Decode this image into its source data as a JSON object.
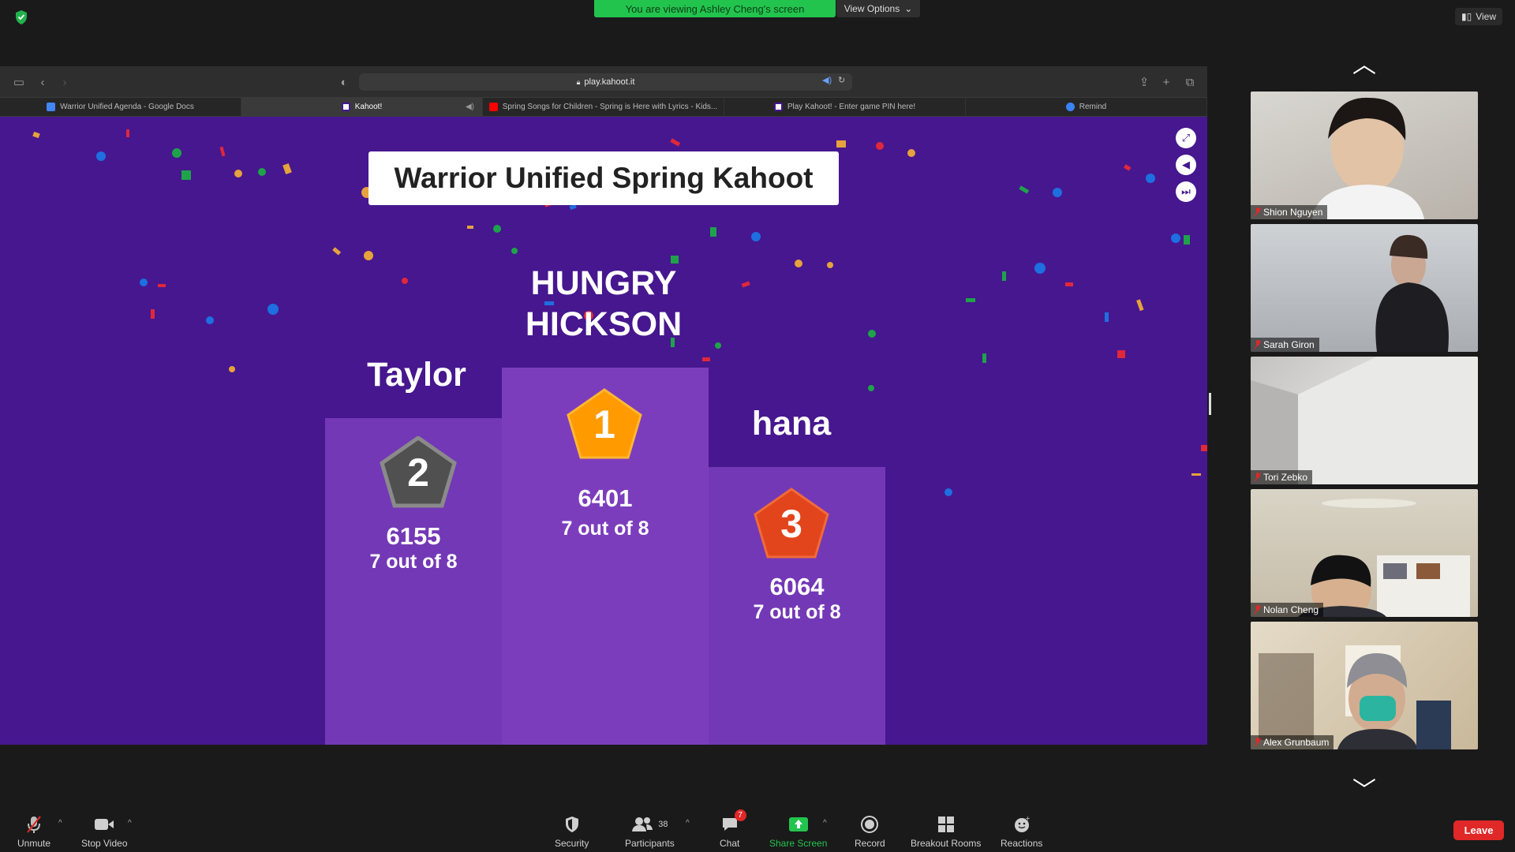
{
  "zoom": {
    "banner": "You are viewing Ashley Cheng's screen",
    "view_options": "View Options",
    "view_label": "View"
  },
  "browser": {
    "url": "play.kahoot.it",
    "tabs": [
      {
        "label": "Warrior Unified Agenda - Google Docs",
        "favicon_color": "#4285f4"
      },
      {
        "label": "Kahoot!",
        "favicon_color": "#46178f"
      },
      {
        "label": "Spring Songs for Children - Spring is Here with Lyrics - Kids...",
        "favicon_color": "#ff0000"
      },
      {
        "label": "Play Kahoot! - Enter game PIN here!",
        "favicon_color": "#46178f"
      },
      {
        "label": "Remind",
        "favicon_color": "#3b82f6"
      }
    ]
  },
  "kahoot": {
    "title": "Warrior Unified Spring Kahoot",
    "colors": {
      "background": "#46178f",
      "podium": "#7c3dbd",
      "gold": "#ff9a00",
      "silver": "#5a5a5a",
      "bronze": "#e2451c"
    },
    "podium": [
      {
        "rank": "1",
        "name": "HUNGRY HICKSON",
        "score": "6401",
        "correct": "7 out of 8"
      },
      {
        "rank": "2",
        "name": "Taylor",
        "score": "6155",
        "correct": "7 out of 8"
      },
      {
        "rank": "3",
        "name": "hana",
        "score": "6064",
        "correct": "7 out of 8"
      }
    ]
  },
  "participants": [
    {
      "name": "Shion Nguyen"
    },
    {
      "name": "Sarah Giron"
    },
    {
      "name": "Tori Zebko"
    },
    {
      "name": "Nolan Cheng"
    },
    {
      "name": "Alex Grunbaum"
    }
  ],
  "toolbar": {
    "unmute": "Unmute",
    "stop_video": "Stop Video",
    "security": "Security",
    "participants": "Participants",
    "participants_count": "38",
    "chat": "Chat",
    "chat_badge": "7",
    "share_screen": "Share Screen",
    "record": "Record",
    "breakout_rooms": "Breakout Rooms",
    "reactions": "Reactions",
    "leave": "Leave"
  }
}
